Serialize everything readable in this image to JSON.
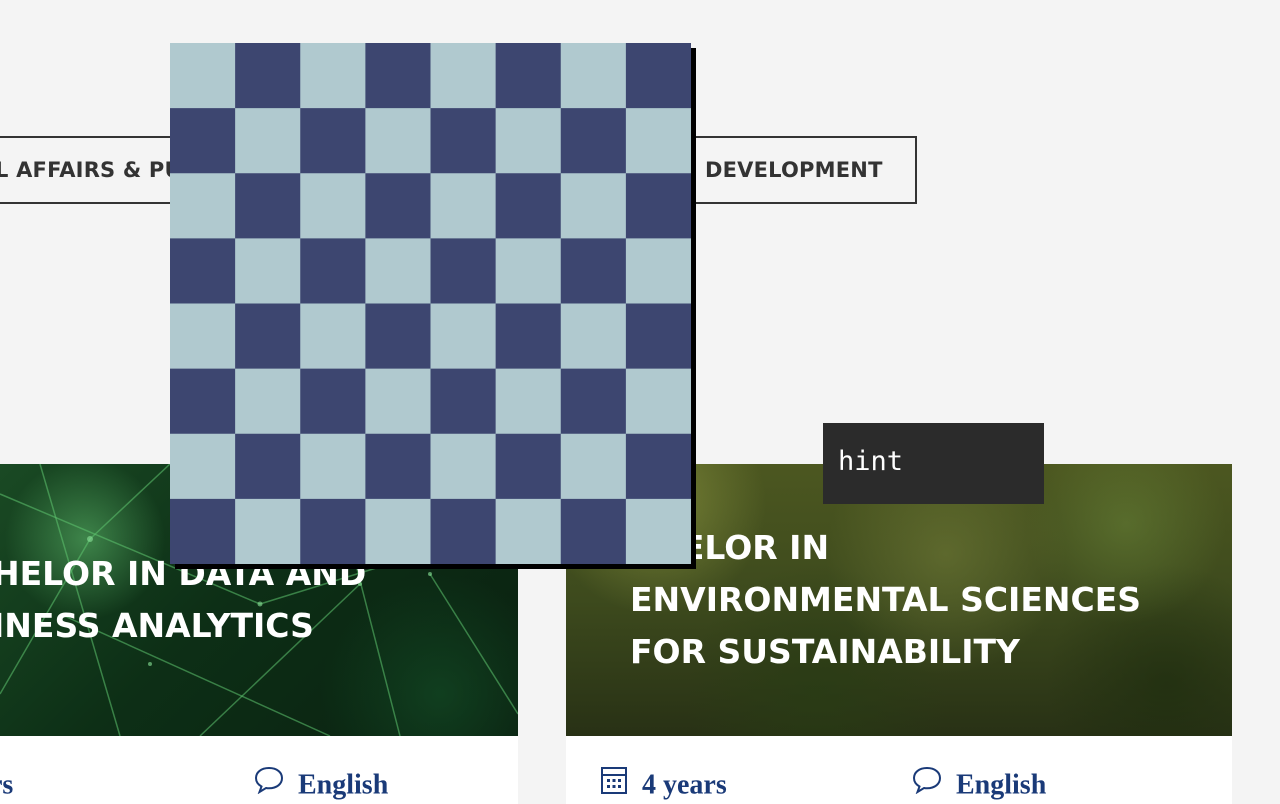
{
  "filters": {
    "left_chip": "L AFFAIRS & PU",
    "right_chip": "DEVELOPMENT"
  },
  "programs": [
    {
      "title_lines": [
        "HELOR IN DATA AND",
        "INESS ANALYTICS"
      ],
      "duration": "rs",
      "language": "English"
    },
    {
      "title_lines": [
        "CHELOR IN",
        "ENVIRONMENTAL SCIENCES",
        "FOR SUSTAINABILITY"
      ],
      "duration": "4 years",
      "language": "English"
    }
  ],
  "overlay": {
    "board_light_color": "#b0c9cf",
    "board_dark_color": "#3d4670",
    "board_size": 8
  },
  "hint": {
    "text": "hint"
  },
  "icons": {
    "duration": "calendar-icon",
    "language": "speech-bubble-icon"
  },
  "colors": {
    "meta_text": "#1a3a78",
    "chip_border": "#333333",
    "page_bg": "#f4f4f4"
  }
}
